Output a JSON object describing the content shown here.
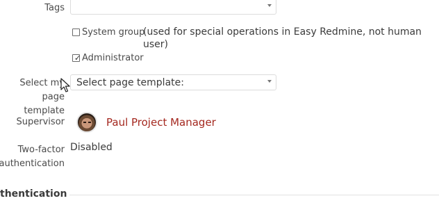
{
  "tags": {
    "label": "Tags",
    "value": ""
  },
  "system_group": {
    "label": "System group",
    "note": "(used for special operations in Easy Redmine, not human user)",
    "checked": false
  },
  "administrator": {
    "label": "Administrator",
    "checked": true
  },
  "page_template": {
    "label_line1": "Select my page",
    "label_line2": "template",
    "value": "Select page template:"
  },
  "supervisor": {
    "label": "Supervisor",
    "name": "Paul Project Manager"
  },
  "two_factor": {
    "label_line1": "Two-factor",
    "label_line2": "authentication",
    "value": "Disabled"
  },
  "section": {
    "title": "thentication"
  },
  "colors": {
    "link": "#a4281f",
    "text": "#3b3b3b",
    "border": "#dcdcdc"
  }
}
